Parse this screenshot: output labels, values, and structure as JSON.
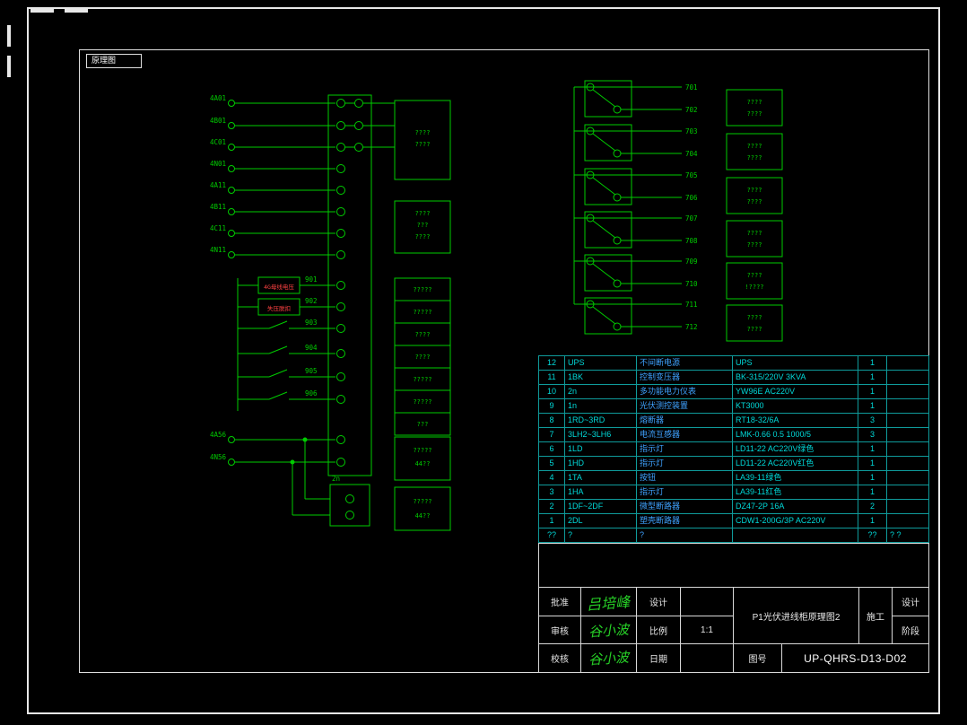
{
  "drawing_label": "原理图",
  "colors": {
    "schematic_green": "#00cc00",
    "table_cyan": "#00d9d9",
    "alert_red": "#ff4242"
  },
  "left_circuit": {
    "feeder_labels": [
      "4A01",
      "4B01",
      "4C01",
      "4N01",
      "4A11",
      "4B11",
      "4C11",
      "4N11"
    ],
    "bottom_feeder_labels": [
      "4A56",
      "4N56"
    ],
    "wire_numbers": [
      "901",
      "902",
      "903",
      "904",
      "905",
      "906"
    ],
    "relay_labels": [
      "4G母线电压",
      "失压脱扣"
    ],
    "meter_label": "2n"
  },
  "middle_panel": {
    "box_a": [
      "????",
      "????"
    ],
    "box_b": [
      "????",
      "???",
      "????"
    ],
    "cells": [
      "?????",
      "?????",
      "????",
      "????",
      "?????",
      "?????",
      "???"
    ],
    "box_c": [
      "?????",
      "44??"
    ],
    "box_d": [
      "?????",
      "44??"
    ]
  },
  "right_circuit": {
    "wire_labels": [
      "701",
      "702",
      "703",
      "704",
      "705",
      "706",
      "707",
      "708",
      "709",
      "710",
      "711",
      "712"
    ],
    "boxes": [
      [
        "????",
        "????"
      ],
      [
        "????",
        "????"
      ],
      [
        "????",
        "????"
      ],
      [
        "????",
        "????"
      ],
      [
        "????",
        "!????"
      ],
      [
        "????",
        "????"
      ]
    ]
  },
  "bom_table": {
    "rows": [
      {
        "no": "12",
        "code": "UPS",
        "name": "不间断电源",
        "model": "UPS",
        "qty": "1",
        "note": ""
      },
      {
        "no": "11",
        "code": "1BK",
        "name": "控制变压器",
        "model": "BK-315/220V 3KVA",
        "qty": "1",
        "note": ""
      },
      {
        "no": "10",
        "code": "2n",
        "name": "多功能电力仪表",
        "model": "YW96E AC220V",
        "qty": "1",
        "note": ""
      },
      {
        "no": "9",
        "code": "1n",
        "name": "光伏测控装置",
        "model": "KT3000",
        "qty": "1",
        "note": ""
      },
      {
        "no": "8",
        "code": "1RD~3RD",
        "name": "熔断器",
        "model": "RT18-32/6A",
        "qty": "3",
        "note": ""
      },
      {
        "no": "7",
        "code": "3LH2~3LH6",
        "name": "电流互感器",
        "model": "LMK-0.66 0.5 1000/5",
        "qty": "3",
        "note": ""
      },
      {
        "no": "6",
        "code": "1LD",
        "name": "指示灯",
        "model": "LD11-22 AC220V绿色",
        "qty": "1",
        "note": ""
      },
      {
        "no": "5",
        "code": "1HD",
        "name": "指示灯",
        "model": "LD11-22 AC220V红色",
        "qty": "1",
        "note": ""
      },
      {
        "no": "4",
        "code": "1TA",
        "name": "按钮",
        "model": "LA39-11绿色",
        "qty": "1",
        "note": ""
      },
      {
        "no": "3",
        "code": "1HA",
        "name": "指示灯",
        "model": "LA39-11红色",
        "qty": "1",
        "note": ""
      },
      {
        "no": "2",
        "code": "1DF~2DF",
        "name": "微型断路器",
        "model": "DZ47-2P 16A",
        "qty": "2",
        "note": ""
      },
      {
        "no": "1",
        "code": "2DL",
        "name": "塑壳断路器",
        "model": "CDW1-200G/3P AC220V",
        "qty": "1",
        "note": ""
      },
      {
        "no": "??",
        "code": "?",
        "name": "?",
        "model": "",
        "qty": "??",
        "note": "? ?"
      }
    ]
  },
  "title_block": {
    "approve_label": "批准",
    "approve_signature": "吕培峰",
    "review_label": "审核",
    "review_signature": "谷小波",
    "check_label": "校核",
    "check_signature": "谷小波",
    "design_label": "设计",
    "scale_label": "比例",
    "scale_value": "1:1",
    "date_label": "日期",
    "drawing_title": "P1光伏进线柜原理图2",
    "construction_label": "施工",
    "stage_label_top": "设计",
    "stage_label_bottom": "阶段",
    "drawing_no_label": "图号",
    "drawing_no": "UP-QHRS-D13-D02"
  }
}
